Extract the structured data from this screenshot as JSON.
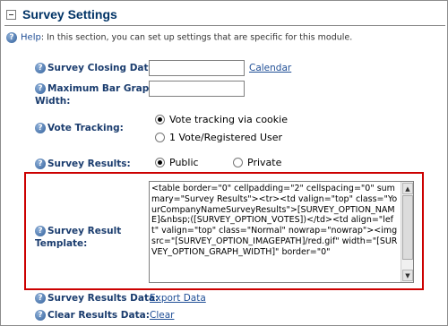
{
  "header": {
    "title": "Survey Settings"
  },
  "help": {
    "link": "Help",
    "text": ": In this section, you can set up settings that are specific for this module."
  },
  "fields": {
    "closing_date": {
      "label": "Survey Closing Date:",
      "value": "",
      "link": "Calendar"
    },
    "max_bar_width": {
      "label_line1": "Maximum Bar Graph",
      "label_line2": "Width:",
      "value": ""
    },
    "vote_tracking": {
      "label": "Vote Tracking:",
      "options": [
        "Vote tracking via cookie",
        "1 Vote/Registered User"
      ],
      "selected": "Vote tracking via cookie"
    },
    "survey_results": {
      "label": "Survey Results:",
      "options": [
        "Public",
        "Private"
      ],
      "selected": "Public"
    },
    "result_template": {
      "label_line1": "Survey Result",
      "label_line2": "Template:",
      "value": "<table border=\"0\" cellpadding=\"2\" cellspacing=\"0\" summary=\"Survey Results\"><tr><td valign=\"top\" class=\"YourCompanyNameSurveyResults\">[SURVEY_OPTION_NAME]&nbsp;([SURVEY_OPTION_VOTES])</td><td align=\"left\" valign=\"top\" class=\"Normal\" nowrap=\"nowrap\"><img src=\"[SURVEY_OPTION_IMAGEPATH]/red.gif\" width=\"[SURVEY_OPTION_GRAPH_WIDTH]\" border=\"0\""
    },
    "results_data": {
      "label": "Survey Results Data:",
      "link": "Export Data"
    },
    "clear_results": {
      "label": "Clear Results Data:",
      "link": "Clear"
    }
  }
}
